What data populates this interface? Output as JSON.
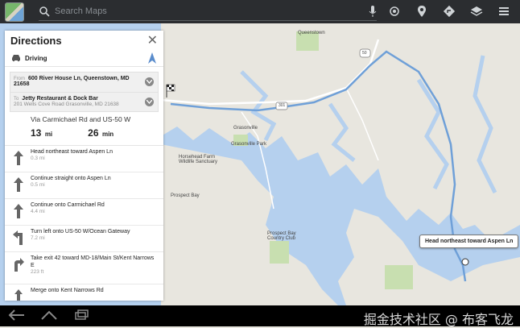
{
  "search": {
    "placeholder": "Search Maps"
  },
  "panel": {
    "title": "Directions",
    "mode": "Driving",
    "from": {
      "tag": "From",
      "main": "600 River House Ln, Queenstown, MD 21658"
    },
    "to": {
      "tag": "To",
      "main": "Jetty Restaurant & Dock Bar",
      "sub": "201 Wells Cove Road Grasonville, MD 21638"
    },
    "summary": {
      "via": "Via Carmichael Rd and US-50 W",
      "distance_value": "13",
      "distance_unit": "mi",
      "time_value": "26",
      "time_unit": "min"
    },
    "steps": [
      {
        "instruction": "Head northeast toward Aspen Ln",
        "distance": "0.3 mi",
        "icon": "arrow-up-icon"
      },
      {
        "instruction": "Continue straight onto Aspen Ln",
        "distance": "0.5 mi",
        "icon": "arrow-up-icon"
      },
      {
        "instruction": "Continue onto Carmichael Rd",
        "distance": "4.4 mi",
        "icon": "arrow-up-icon"
      },
      {
        "instruction": "Turn left onto US-50 W/Ocean Gateway",
        "distance": "7.2 mi",
        "icon": "turn-left-icon"
      },
      {
        "instruction": "Take exit 42 toward MD-18/Main St/Kent Narrows E",
        "distance": "223 ft",
        "icon": "exit-right-icon"
      },
      {
        "instruction": "Merge onto Kent Narrows Rd",
        "distance": "",
        "icon": "merge-icon"
      }
    ]
  },
  "map": {
    "labels": {
      "queenstown": "Queenstown",
      "grasonville": "Grasonville",
      "grasonville_park": "Grasonville Park",
      "horsehead": "Horsehead Farm Wildlife Sanctuary",
      "prospect_bay": "Prospect Bay",
      "prospect_bay_club": "Prospect Bay Country Club",
      "shield_301": "301",
      "shield_50": "50"
    },
    "callout": "Head northeast toward Aspen Ln",
    "colors": {
      "water": "#b5d0ee",
      "land": "#e8e6df",
      "route": "#6fa0d8",
      "park": "#c8dfb0"
    }
  },
  "navbar": {
    "watermark": "掘金技术社区 @ 布客飞龙"
  }
}
